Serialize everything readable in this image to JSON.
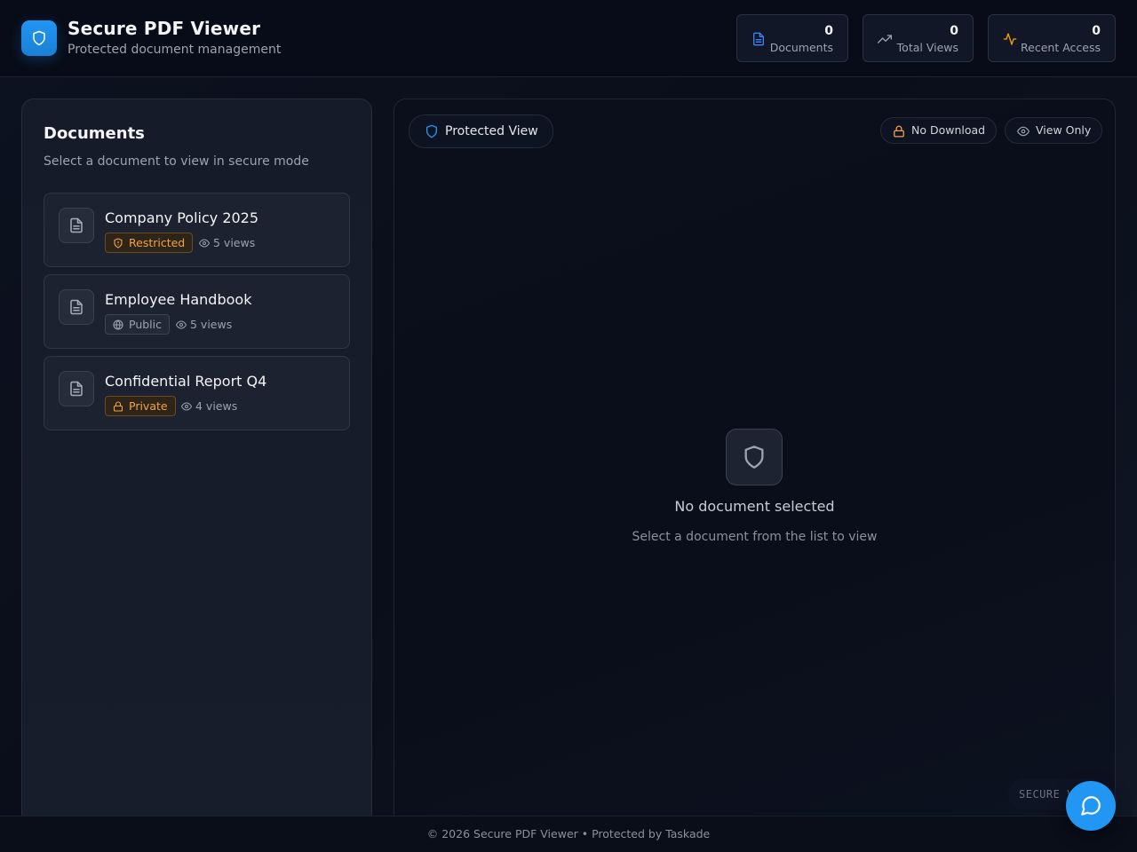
{
  "header": {
    "title": "Secure PDF Viewer",
    "subtitle": "Protected document management",
    "logo_icon": "shield-icon",
    "stats": [
      {
        "value": "0",
        "label": "Documents",
        "icon": "file-text-icon",
        "color": "#3b82f6"
      },
      {
        "value": "0",
        "label": "Total Views",
        "icon": "trending-up-icon",
        "color": "#9ca3af"
      },
      {
        "value": "0",
        "label": "Recent Access",
        "icon": "activity-icon",
        "color": "#f59e0b"
      }
    ]
  },
  "sidebar": {
    "title": "Documents",
    "description": "Select a document to view in secure mode",
    "documents": [
      {
        "name": "Company Policy 2025",
        "access": "Restricted",
        "access_icon": "shield-alert-icon",
        "views": "5 views"
      },
      {
        "name": "Employee Handbook",
        "access": "Public",
        "access_icon": "globe-icon",
        "views": "5 views"
      },
      {
        "name": "Confidential Report Q4",
        "access": "Private",
        "access_icon": "lock-icon",
        "views": "4 views"
      }
    ]
  },
  "viewer": {
    "mode_label": "Protected View",
    "no_download_label": "No Download",
    "view_only_label": "View Only",
    "empty_title": "No document selected",
    "empty_subtitle": "Select a document from the list to view",
    "watermark": "SECURE V"
  },
  "footer": {
    "text": "© 2026 Secure PDF Viewer • Protected by Taskade"
  },
  "colors": {
    "accent": "#2196f3",
    "warning": "#f0a347",
    "background": "#0a0e1a"
  }
}
